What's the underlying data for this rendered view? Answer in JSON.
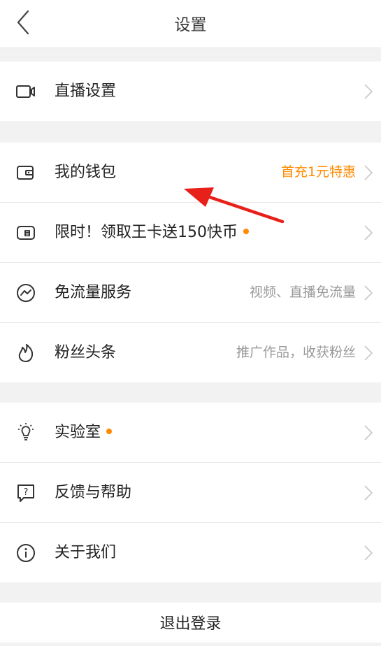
{
  "header": {
    "title": "设置"
  },
  "groups": [
    {
      "items": [
        {
          "label": "直播设置",
          "icon": "video-camera-icon"
        }
      ]
    },
    {
      "items": [
        {
          "label": "我的钱包",
          "hint": "首充1元特惠",
          "icon": "wallet-icon"
        },
        {
          "label": "限时！领取王卡送150快币",
          "icon": "sim-card-icon",
          "dot": true
        },
        {
          "label": "免流量服务",
          "hint": "视频、直播免流量",
          "icon": "traffic-icon"
        },
        {
          "label": "粉丝头条",
          "hint": "推广作品，收获粉丝",
          "icon": "flame-icon"
        }
      ]
    },
    {
      "items": [
        {
          "label": "实验室",
          "icon": "lightbulb-icon",
          "dot": true
        },
        {
          "label": "反馈与帮助",
          "icon": "feedback-icon"
        },
        {
          "label": "关于我们",
          "icon": "info-icon"
        }
      ]
    }
  ],
  "logout": {
    "label": "退出登录"
  },
  "colors": {
    "accent": "#ff8a00",
    "annotation_arrow": "#e8201a",
    "chevron": "#c8c8c8"
  }
}
